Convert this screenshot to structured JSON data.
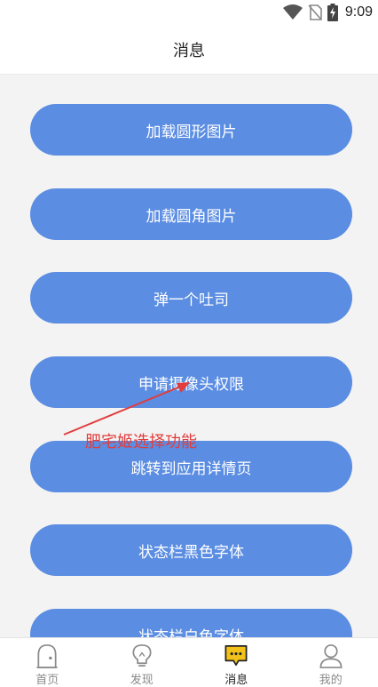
{
  "status_bar": {
    "time": "9:09"
  },
  "header": {
    "title": "消息"
  },
  "buttons": [
    {
      "label": "加载圆形图片"
    },
    {
      "label": "加载圆角图片"
    },
    {
      "label": "弹一个吐司"
    },
    {
      "label": "申请摄像头权限"
    },
    {
      "label": "跳转到应用详情页"
    },
    {
      "label": "状态栏黑色字体"
    },
    {
      "label": "状态栏白色字体"
    }
  ],
  "annotation": {
    "text": "肥宅姬选择功能",
    "color": "#e23c3c"
  },
  "tabs": [
    {
      "label": "首页",
      "icon": "home-icon"
    },
    {
      "label": "发现",
      "icon": "lightbulb-icon"
    },
    {
      "label": "消息",
      "icon": "message-icon",
      "active": true
    },
    {
      "label": "我的",
      "icon": "person-icon"
    }
  ],
  "colors": {
    "button": "#5b8de2",
    "background": "#f3f3f3",
    "active_tab_icon": "#f2c21b"
  }
}
